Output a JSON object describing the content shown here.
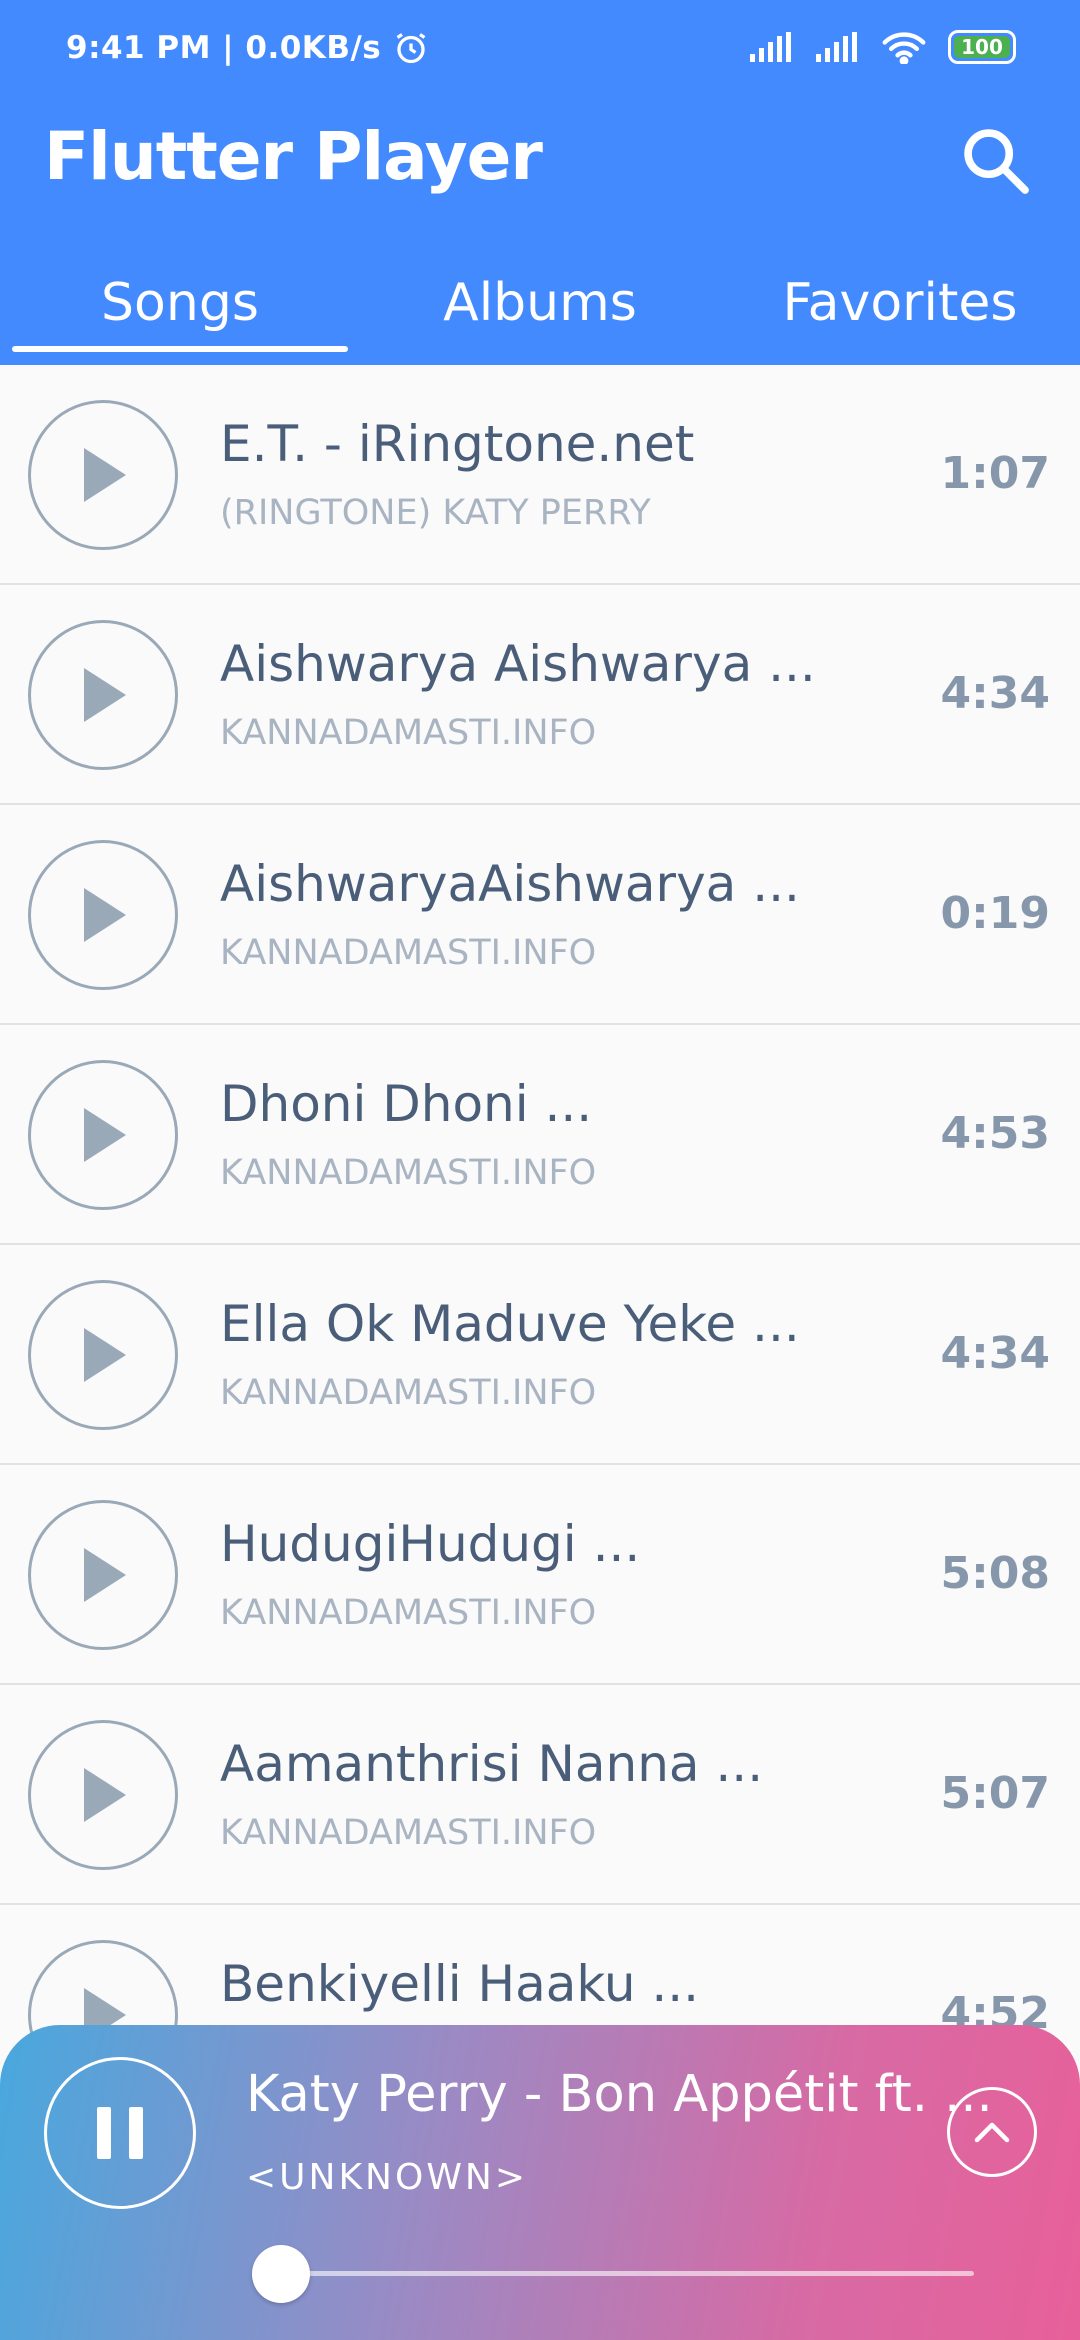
{
  "status_bar": {
    "time_text": "9:41 PM | 0.0KB/s",
    "battery": "100"
  },
  "app": {
    "title": "Flutter Player"
  },
  "tabs": [
    {
      "label": "Songs",
      "active": true
    },
    {
      "label": "Albums",
      "active": false
    },
    {
      "label": "Favorites",
      "active": false
    }
  ],
  "songs": [
    {
      "title": "E.T. - iRingtone.net",
      "artist": "(RINGTONE) KATY PERRY",
      "duration": "1:07"
    },
    {
      "title": "Aishwarya Aishwarya ...",
      "artist": "KANNADAMASTI.INFO",
      "duration": "4:34"
    },
    {
      "title": "AishwaryaAishwarya ...",
      "artist": "KANNADAMASTI.INFO",
      "duration": "0:19"
    },
    {
      "title": "Dhoni Dhoni ...",
      "artist": "KANNADAMASTI.INFO",
      "duration": "4:53"
    },
    {
      "title": "Ella Ok Maduve Yeke ...",
      "artist": "KANNADAMASTI.INFO",
      "duration": "4:34"
    },
    {
      "title": "HudugiHudugi ...",
      "artist": "KANNADAMASTI.INFO",
      "duration": "5:08"
    },
    {
      "title": "Aamanthrisi Nanna ...",
      "artist": "KANNADAMASTI.INFO",
      "duration": "5:07"
    },
    {
      "title": "Benkiyelli Haaku ...",
      "artist": "",
      "duration": "4:52"
    }
  ],
  "now_playing": {
    "title": "Katy Perry - Bon Appétit ft. ...",
    "artist": "<UNKNOWN>",
    "progress": 0.04
  },
  "icons": {
    "search": "search-icon",
    "play": "play-icon",
    "pause": "pause-icon",
    "expand": "chevron-up-icon"
  },
  "colors": {
    "primary": "#448aff",
    "player_gradient_start": "#48a8de",
    "player_gradient_end": "#e8609a",
    "battery": "#4caf50"
  }
}
